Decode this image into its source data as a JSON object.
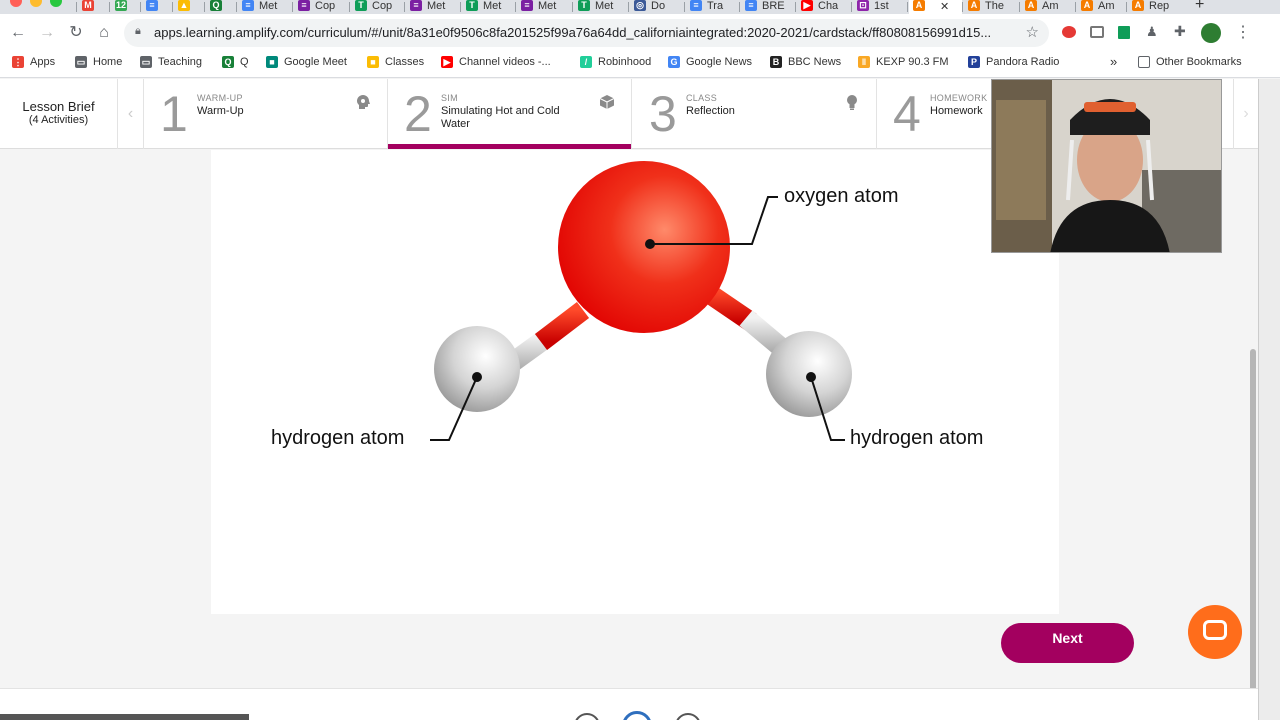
{
  "browser": {
    "tabs": [
      {
        "label": "",
        "color": "#ea4335",
        "glyph": "M"
      },
      {
        "label": "",
        "color": "#34a853",
        "glyph": "12"
      },
      {
        "label": "",
        "color": "#4285f4",
        "glyph": "≡"
      },
      {
        "label": "",
        "color": "#fbbc04",
        "glyph": "▲"
      },
      {
        "label": "",
        "color": "#188038",
        "glyph": "Q"
      },
      {
        "label": "Met",
        "color": "#4285f4",
        "glyph": "≡"
      },
      {
        "label": "Cop",
        "color": "#7b1fa2",
        "glyph": "≡"
      },
      {
        "label": "Cop",
        "color": "#0f9d58",
        "glyph": "T"
      },
      {
        "label": "Met",
        "color": "#7b1fa2",
        "glyph": "≡"
      },
      {
        "label": "Met",
        "color": "#0f9d58",
        "glyph": "T"
      },
      {
        "label": "Met",
        "color": "#7b1fa2",
        "glyph": "≡"
      },
      {
        "label": "Met",
        "color": "#0f9d58",
        "glyph": "T"
      },
      {
        "label": "Do",
        "color": "#3b5998",
        "glyph": "◎"
      },
      {
        "label": "Tra",
        "color": "#4285f4",
        "glyph": "≡"
      },
      {
        "label": "BRE",
        "color": "#4285f4",
        "glyph": "≡"
      },
      {
        "label": "Cha",
        "color": "#ff0000",
        "glyph": "▶"
      },
      {
        "label": "1st",
        "color": "#8e24aa",
        "glyph": "⊡"
      },
      {
        "label": "",
        "color": "#f57c00",
        "glyph": "A"
      },
      {
        "label": "The",
        "color": "#f57c00",
        "glyph": "A"
      },
      {
        "label": "Am",
        "color": "#f57c00",
        "glyph": "A"
      },
      {
        "label": "Am",
        "color": "#f57c00",
        "glyph": "A"
      },
      {
        "label": "Rep",
        "color": "#f57c00",
        "glyph": "A"
      }
    ],
    "url": "apps.learning.amplify.com/curriculum/#/unit/8a31e0f9506c8fa201525f99a76a64dd_californiaintegrated:2020-2021/cardstack/ff80808156991d15...",
    "bookmarks": [
      {
        "label": "Apps",
        "color": "#ea4335",
        "glyph": "⋮"
      },
      {
        "label": "Home",
        "color": "#5f6368",
        "glyph": "▭"
      },
      {
        "label": "Teaching",
        "color": "#5f6368",
        "glyph": "▭"
      },
      {
        "label": "Q",
        "color": "#188038",
        "glyph": "Q"
      },
      {
        "label": "Google Meet",
        "color": "#00897b",
        "glyph": "■"
      },
      {
        "label": "Classes",
        "color": "#fbbc04",
        "glyph": "■"
      },
      {
        "label": "Channel videos -...",
        "color": "#ff0000",
        "glyph": "▶"
      },
      {
        "label": "Robinhood",
        "color": "#21ce99",
        "glyph": "/"
      },
      {
        "label": "Google News",
        "color": "#4285f4",
        "glyph": "G"
      },
      {
        "label": "BBC News",
        "color": "#222222",
        "glyph": "B"
      },
      {
        "label": "KEXP 90.3 FM",
        "color": "#f9a825",
        "glyph": "‖"
      },
      {
        "label": "Pandora Radio",
        "color": "#224099",
        "glyph": "P"
      }
    ],
    "more_bookmarks": "»",
    "other_bookmarks": "Other Bookmarks"
  },
  "lesson": {
    "brief_title": "Lesson Brief",
    "brief_sub": "(4 Activities)",
    "steps": [
      {
        "num": "1",
        "category": "WARM-UP",
        "name": "Warm-Up",
        "icon": "head-gear-icon"
      },
      {
        "num": "2",
        "category": "SIM",
        "name": "Simulating Hot and Cold Water",
        "icon": "cube-icon"
      },
      {
        "num": "3",
        "category": "CLASS",
        "name": "Reflection",
        "icon": "lightbulb-icon"
      },
      {
        "num": "4",
        "category": "HOMEWORK",
        "name": "Homework",
        "icon": "house-icon"
      }
    ],
    "active_step": 2,
    "accent_color": "#a3005f"
  },
  "diagram": {
    "oxygen_label": "oxygen atom",
    "hydrogen_left_label": "hydrogen atom",
    "hydrogen_right_label": "hydrogen atom"
  },
  "footer": {
    "next_label": "Next"
  }
}
